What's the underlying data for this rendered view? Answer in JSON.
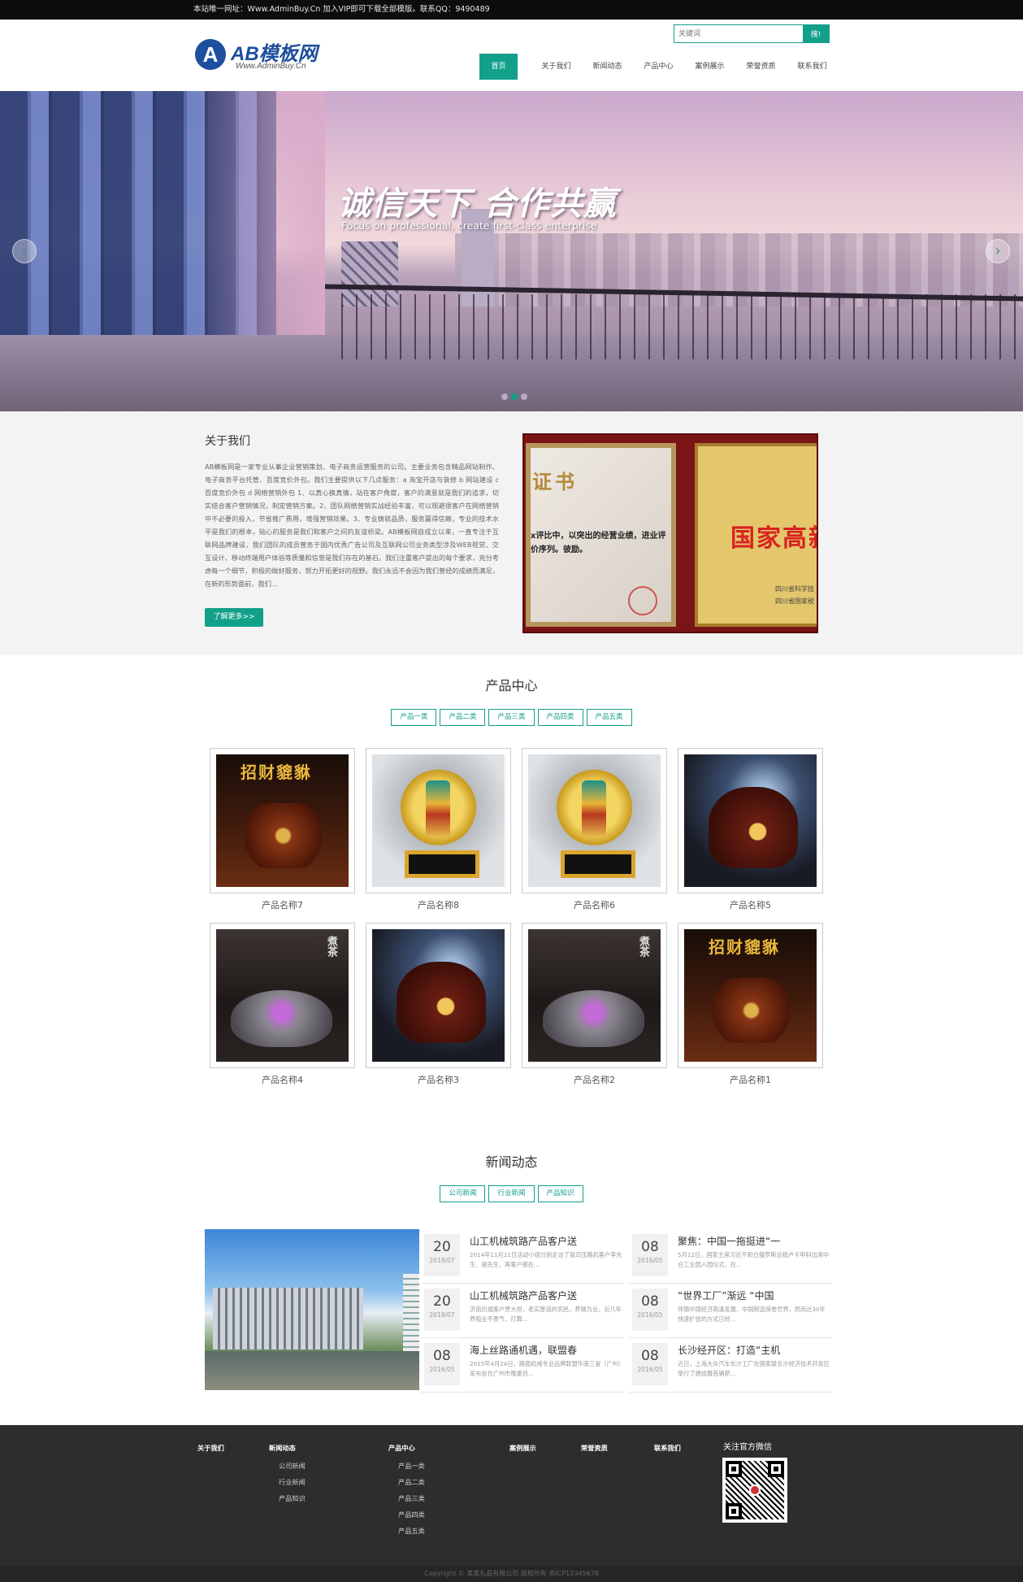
{
  "topbar": {
    "text": "本站唯一网址：Www.AdminBuy.Cn 加入VIP即可下载全部模版。联系QQ：9490489"
  },
  "logo": {
    "mark": "A",
    "main": "AB模板网",
    "sub": "Www.AdminBuy.Cn"
  },
  "search": {
    "placeholder": "关键词",
    "button": "搜!"
  },
  "nav": [
    "首页",
    "关于我们",
    "新闻动态",
    "产品中心",
    "案例展示",
    "荣誉资质",
    "联系我们"
  ],
  "banner": {
    "slogan": "诚信天下  合作共赢",
    "subtitle": "Focus on professional, create first-class enterprise",
    "prev_icon": "chevron-left-icon",
    "next_icon": "chevron-right-icon",
    "prev": "‹",
    "next": "›"
  },
  "about": {
    "title": "关于我们",
    "text": "AB模板网是一家专业从事企业营销策划、电子商务运营服务的公司。主要业务包含精品网站制作、电子商务平台托管、百度竞价外包。我们主要提供以下几点服务：a 淘宝开店与装修 b 网站建设 c 百度竞价外包 d 网络营销外包 1、以真心换真情，站在客户角度，客户的满意就是我们的追求，切实结合客户营销情况，制定营销方案。2、团队网络营销实战经验丰富，可以规避很客户在网络营销中不必要的投入，节省推广费用，增强营销效果。3、专业铸就品质，服务赢得信赖，专业的技术水平是我们的根本，贴心的服务是我们和客户之间的友谊桥梁。AB模板网自成立以来，一直专注于互联网品牌建设，我们团队的成员曾务于国内优秀广告公司及互联网公司业务类型涉及WEB视觉、交互设计、移动终端用户体验等质量和信誉是我们存在的基石。我们注重客户提出的每个要求，充分考虑每一个细节，积极的做好服务，努力开拓更好的视野。我们永远不会因为我们曾经的成绩而满足，在新的形势面前，我们...",
    "more": "了解更多>>",
    "cert1_title": "证书",
    "cert1_text": "x评比中，以突出的经营业绩，进业评价序列。彼励。",
    "cert2_title": "国家高新",
    "cert2_text": "四川省科学技\n四川省国家税"
  },
  "products": {
    "title": "产品中心",
    "tabs": [
      "产品一类",
      "产品二类",
      "产品三类",
      "产品四类",
      "产品五类"
    ],
    "items": [
      {
        "name": "产品名称7",
        "theme": "t-rich"
      },
      {
        "name": "产品名称8",
        "theme": "t-gold"
      },
      {
        "name": "产品名称6",
        "theme": "t-gold"
      },
      {
        "name": "产品名称5",
        "theme": "t-dragon"
      },
      {
        "name": "产品名称4",
        "theme": "t-tea"
      },
      {
        "name": "产品名称3",
        "theme": "t-dragon"
      },
      {
        "name": "产品名称2",
        "theme": "t-tea"
      },
      {
        "name": "产品名称1",
        "theme": "t-rich"
      }
    ]
  },
  "news": {
    "title": "新闻动态",
    "tabs": [
      "公司新闻",
      "行业新闻",
      "产品知识"
    ],
    "col1": [
      {
        "day": "20",
        "ym": "2018/07",
        "title": "山工机械筑路产品客户送",
        "summary": "2014年11月21日活动小组分别走访了我司压路机客户李先生、胡先生，再客户那在..."
      },
      {
        "day": "20",
        "ym": "2018/07",
        "title": "山工机械筑路产品客户送",
        "summary": "济南历城客户贾大坦，老实厚道的农民，养猪为业，近几年养殖业不景气，打算..."
      },
      {
        "day": "08",
        "ym": "2016/05",
        "title": "海上丝路通机遇，联盟春",
        "summary": "2015年4月24日，路面机械专业品牌联盟华南三省（广州）发布会在广州市隆重召..."
      }
    ],
    "col2": [
      {
        "day": "08",
        "ym": "2016/05",
        "title": "聚焦：中国一拖挺进“一",
        "summary": "5月12日，国家主席习近平和白俄罗斯总统卢卡申科出席中白工业园入园仪式，在..."
      },
      {
        "day": "08",
        "ym": "2016/05",
        "title": "“世界工厂”渐远 “中国",
        "summary": "伴随中国经济高速发展，中国制造席卷世界，然而近30年快速扩张的方式已经..."
      },
      {
        "day": "08",
        "ym": "2016/05",
        "title": "长沙经开区：打造“主机",
        "summary": "近日，上海大众汽车长沙工厂在国家级长沙经济技术开发区举行了建成暨首辆轿..."
      }
    ]
  },
  "footer": {
    "cols": [
      {
        "title": "关于我们",
        "subs": []
      },
      {
        "title": "新闻动态",
        "subs": [
          "公司新闻",
          "行业新闻",
          "产品知识"
        ]
      },
      {
        "title": "产品中心",
        "subs": [
          "产品一类",
          "产品二类",
          "产品三类",
          "产品四类",
          "产品五类"
        ]
      },
      {
        "title": "案例展示",
        "subs": []
      },
      {
        "title": "荣誉资质",
        "subs": []
      },
      {
        "title": "联系我们",
        "subs": []
      }
    ],
    "qr_title": "关注官方微信",
    "copyright": "Copyright © 某某礼品有限公司 版权所有   苏ICP12345678"
  },
  "colors": {
    "accent": "#13a089",
    "footer": "#2d2d2d",
    "topbar": "#0d0d0d"
  }
}
